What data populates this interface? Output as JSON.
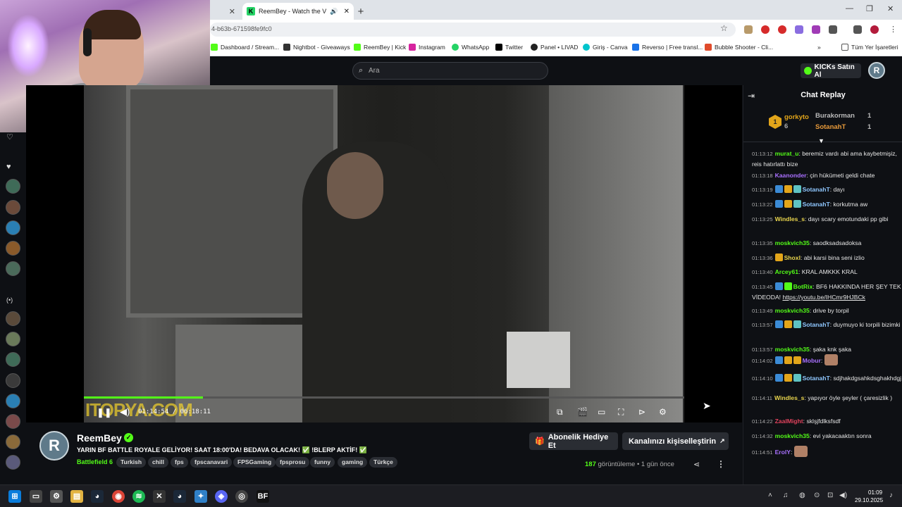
{
  "browser": {
    "active_tab_title": "ReemBey - Watch the VOD",
    "url_fragment": "4-b63b-671598fe9fc0",
    "bookmarks": [
      {
        "label": "Dashboard / Stream...",
        "color": "#53fc18"
      },
      {
        "label": "Nightbot - Giveaways",
        "color": "#333333"
      },
      {
        "label": "ReemBey | Kick",
        "color": "#53fc18"
      },
      {
        "label": "Instagram",
        "color": "#d6249f"
      },
      {
        "label": "WhatsApp",
        "color": "#25d366"
      },
      {
        "label": "Twitter",
        "color": "#000000"
      },
      {
        "label": "Panel • LIVAD",
        "color": "#222222"
      },
      {
        "label": "Giriş - Canva",
        "color": "#00c4cc"
      },
      {
        "label": "Reverso | Free transl...",
        "color": "#1a73e8"
      },
      {
        "label": "Bubble Shooter - Cli...",
        "color": "#e04b2b"
      }
    ],
    "all_bookmarks_label": "Tüm Yer İşaretleri"
  },
  "header": {
    "search_placeholder": "Ara",
    "buy_kicks_label": "KICKs Satın Al"
  },
  "player": {
    "time_display": "01:14:54 / 06:18:11",
    "progress_fraction": 0.198,
    "watermark": "ITOPYA.COM"
  },
  "channel": {
    "avatar_letter": "R",
    "name": "ReemBey",
    "stream_title": "YARIN BF BATTLE ROYALE GELİYOR! SAAT 18:00'DA! BEDAVA OLACAK! ✅ !BLERP AKTİF! ✅",
    "category": "Battlefield 6",
    "tags": [
      "Turkish",
      "chill",
      "fps",
      "fpscanavari",
      "FPSGaming",
      "fpsprosu",
      "funny",
      "gaming",
      "Türkçe"
    ],
    "gift_label": "Abonelik Hediye Et",
    "customize_label": "Kanalınızı kişiselleştirin",
    "views_count": "187",
    "views_label": "görüntüleme",
    "age": "1 gün önce"
  },
  "chat": {
    "title": "Chat Replay",
    "leaderboard": [
      {
        "name": "gorkyto",
        "count": "6",
        "color": "#e2a51a"
      },
      {
        "name": "Burakorman",
        "count": "1",
        "color": "#bbbbbb"
      },
      {
        "name": "SotanahT",
        "count": "1",
        "color": "#e89a3a"
      }
    ],
    "messages": [
      {
        "ts": "01:13:12",
        "name": "murat_u",
        "color": "#53fc18",
        "text": "beremiz vardı abi ama kaybetmişiz, reis hatırlattı bize"
      },
      {
        "ts": "01:13:18",
        "name": "Kaanonder",
        "color": "#a970ff",
        "text": "çin hükümeti geldi chate"
      },
      {
        "ts": "01:13:19",
        "name": "SotanahT",
        "color": "#8fc7ff",
        "text": "dayı"
      },
      {
        "ts": "01:13:22",
        "name": "SotanahT",
        "color": "#8fc7ff",
        "text": "korkutma aw"
      },
      {
        "ts": "01:13:25",
        "name": "Windles_s",
        "color": "#e8d44d",
        "text": "dayı scary emotundaki pp gibi"
      },
      {
        "ts": "01:13:35",
        "name": "moskvich35",
        "color": "#53fc18",
        "text": "saodksadsadoksa"
      },
      {
        "ts": "01:13:36",
        "name": "Shoxl",
        "color": "#e8d44d",
        "text": "abi karsi bina seni izlio"
      },
      {
        "ts": "01:13:40",
        "name": "Arcey61",
        "color": "#53fc18",
        "text": "KRAL AMKKK KRAL"
      },
      {
        "ts": "01:13:45",
        "name": "BotRix",
        "color": "#53fc18",
        "text": "BF6 HAKKINDA HER ŞEY TEK VİDEODA!",
        "link": "https://youtu.be/IHCmr9HJBCk"
      },
      {
        "ts": "01:13:49",
        "name": "moskvich35",
        "color": "#53fc18",
        "text": "drive by torpil"
      },
      {
        "ts": "01:13:57",
        "name": "SotanahT",
        "color": "#8fc7ff",
        "text": "duymuyo ki torpili bizimki"
      },
      {
        "ts": "01:13:57",
        "name": "moskvich35",
        "color": "#53fc18",
        "text": "şaka knk şaka"
      },
      {
        "ts": "01:14:02",
        "name": "Mobur",
        "color": "#a970ff",
        "text": ""
      },
      {
        "ts": "01:14:10",
        "name": "SotanahT",
        "color": "#8fc7ff",
        "text": "sdjhakdgsahkdsghakhdgj"
      },
      {
        "ts": "01:14:11",
        "name": "Windles_s",
        "color": "#e8d44d",
        "text": "yapıyor öyle şeyler ( çaresizlik )"
      },
      {
        "ts": "01:14:22",
        "name": "ZaalMight",
        "color": "#e0425c",
        "text": "sklşjfdlksfsdf"
      },
      {
        "ts": "01:14:32",
        "name": "moskvich35",
        "color": "#53fc18",
        "text": "evi yakacaaktın sonra"
      },
      {
        "ts": "01:14:51",
        "name": "ErolY",
        "color": "#a970ff",
        "text": ""
      }
    ]
  },
  "taskbar": {
    "time": "01:09",
    "date": "29.10.2025"
  }
}
